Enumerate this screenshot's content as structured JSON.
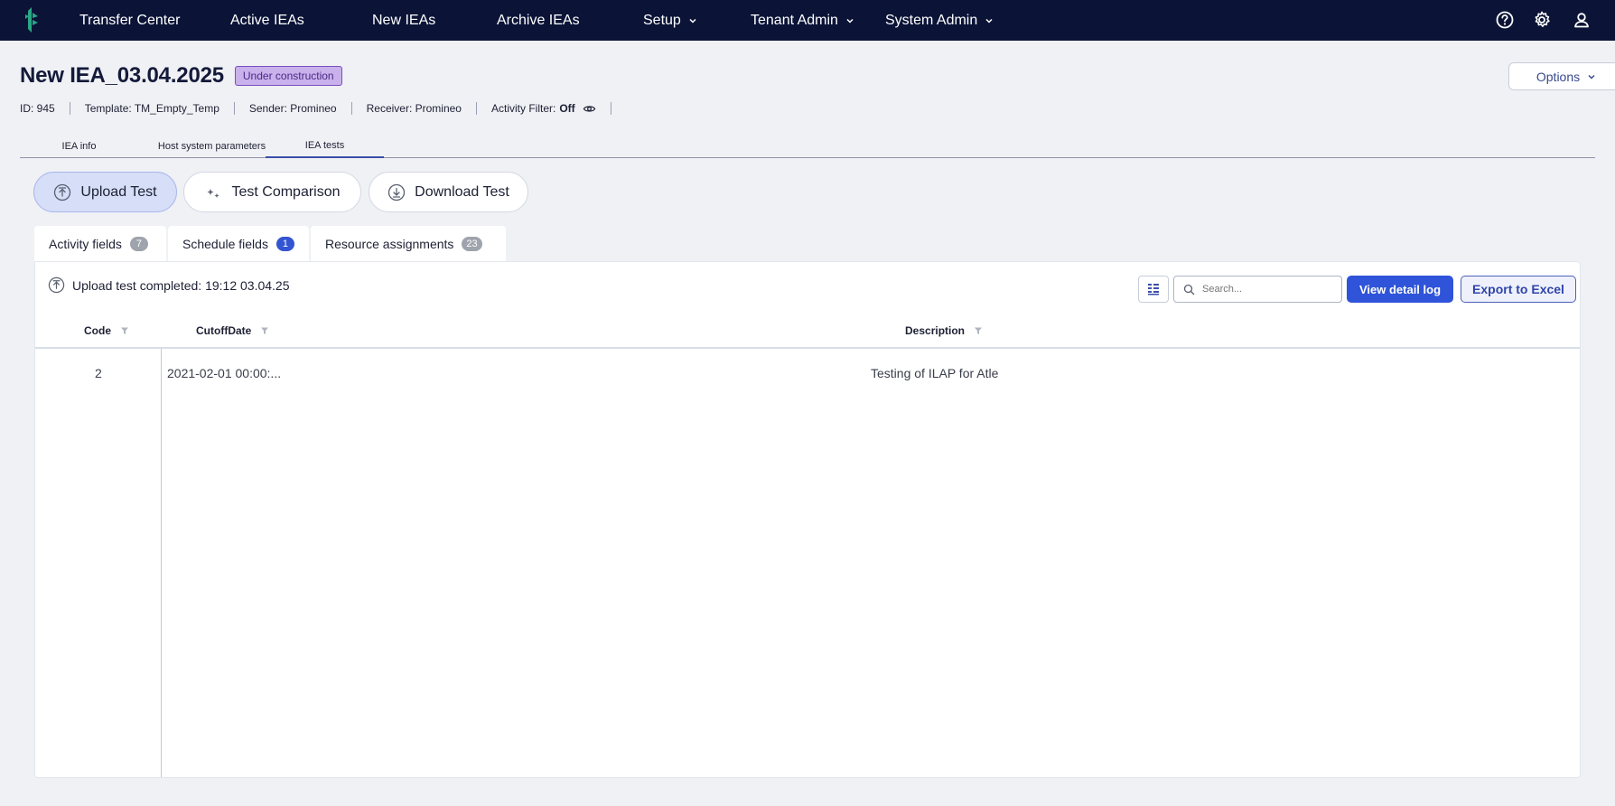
{
  "nav": {
    "items": [
      {
        "label": "Transfer Center"
      },
      {
        "label": "Active IEAs"
      },
      {
        "label": "New IEAs"
      },
      {
        "label": "Archive IEAs"
      },
      {
        "label": "Setup"
      },
      {
        "label": "Tenant Admin"
      },
      {
        "label": "System Admin"
      }
    ],
    "icons": [
      "help-icon",
      "gear-icon",
      "user-icon"
    ]
  },
  "header": {
    "title": "New IEA_03.04.2025",
    "status": "Under construction",
    "options_label": "Options"
  },
  "meta": {
    "id": "ID: 945",
    "template": "Template: TM_Empty_Temp",
    "sender": "Sender: Promineo",
    "receiver": "Receiver: Promineo",
    "activity_filter_label": "Activity Filter:",
    "activity_filter_value": "Off"
  },
  "section_tabs": [
    {
      "label": "IEA info"
    },
    {
      "label": "Host system parameters"
    },
    {
      "label": "IEA tests",
      "active": true
    }
  ],
  "actions": {
    "upload": "Upload Test",
    "compare": "Test Comparison",
    "download": "Download Test"
  },
  "sub_tabs": [
    {
      "label": "Activity fields",
      "count": "7"
    },
    {
      "label": "Schedule fields",
      "count": "1",
      "active": true
    },
    {
      "label": "Resource assignments",
      "count": "23"
    }
  ],
  "panel": {
    "upload_status": "Upload test completed: 19:12 03.04.25",
    "search_placeholder": "Search...",
    "view_log": "View detail log",
    "export": "Export to Excel"
  },
  "grid": {
    "columns": [
      "Code",
      "CutoffDate",
      "Description"
    ],
    "rows": [
      {
        "code": "2",
        "cutoff": "2021-02-01 00:00:...",
        "description": "Testing of ILAP for Atle"
      }
    ]
  },
  "colors": {
    "nav_bg": "#0b1437",
    "primary": "#2f54d9",
    "badge_purple": "#c9b1ec"
  }
}
